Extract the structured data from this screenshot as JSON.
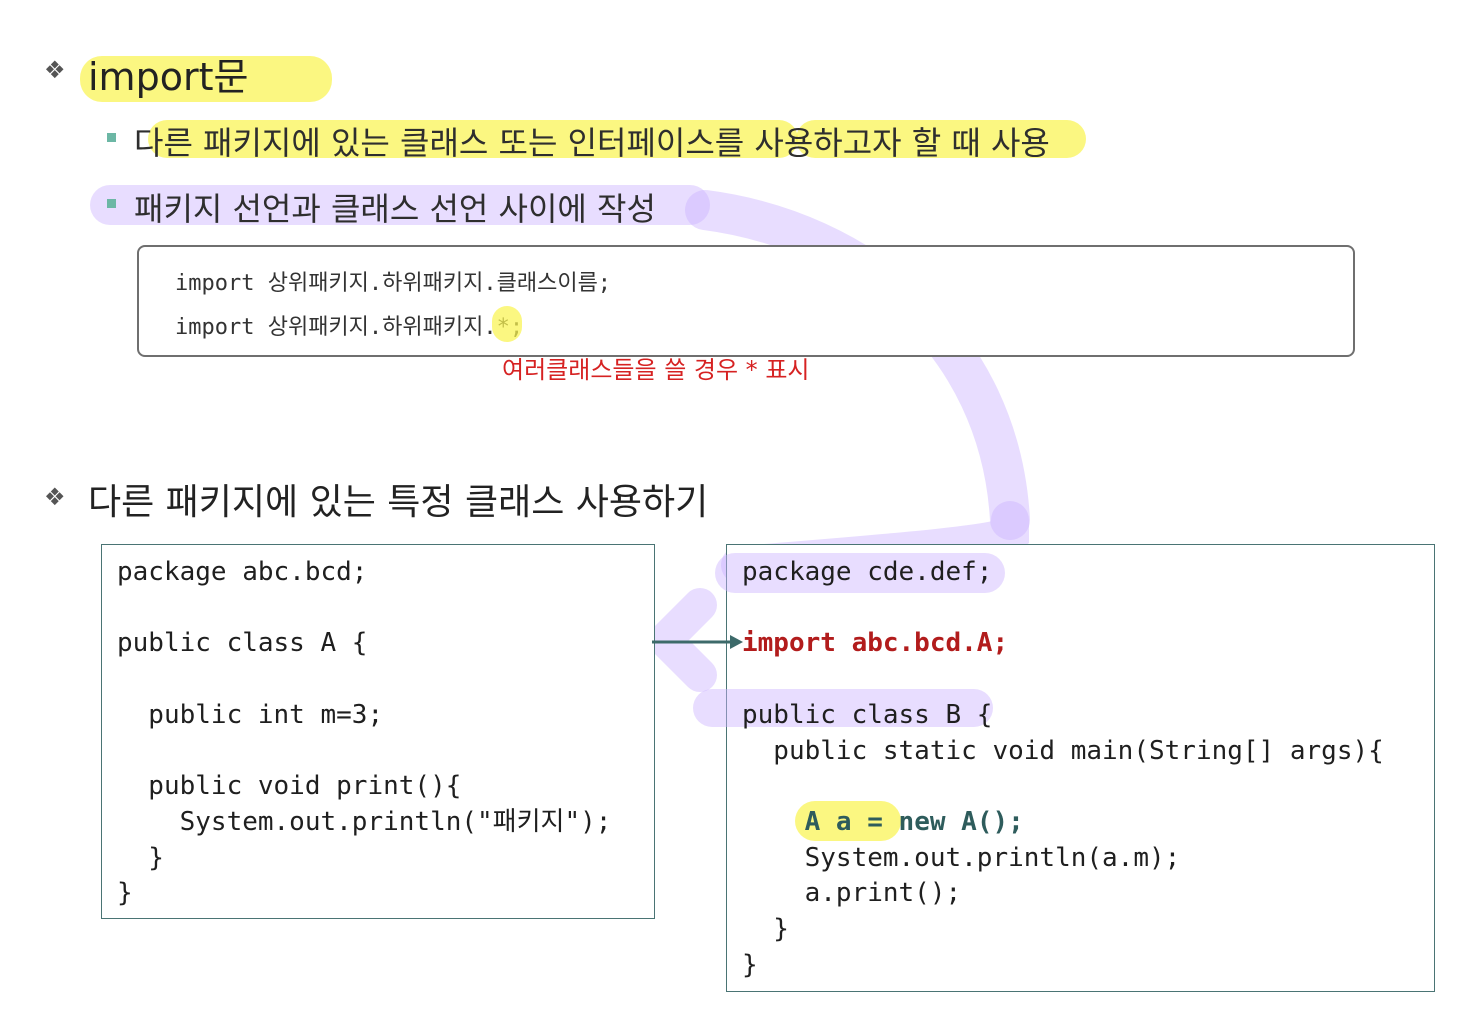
{
  "section1": {
    "title": "import문",
    "items": [
      "다른 패키지에 있는 클래스 또는 인터페이스를 사용하고자 할 때 사용",
      "패키지 선언과 클래스 선언 사이에 작성"
    ],
    "code_lines": [
      "import 상위패키지.하위패키지.클래스이름;",
      "import 상위패키지.하위패키지.*;"
    ],
    "note": "여러클래스들을 쓸 경우 * 표시"
  },
  "section2": {
    "title": "다른 패키지에 있는 특정 클래스 사용하기",
    "left_code": {
      "l1": "package abc.bcd;",
      "l2": "public class A {",
      "l3": "  public int m=3;",
      "l4": "  public void print(){",
      "l5": "    System.out.println(\"패키지\");",
      "l6": "  }",
      "l7": "}"
    },
    "right_code": {
      "l1": "package cde.def;",
      "import": "import abc.bcd.A;",
      "l2": "public class B {",
      "l3": "  public static void main(String[] args){",
      "l4a": "    A a = ",
      "l4b": "new A();",
      "l5": "    System.out.println(a.m);",
      "l6": "    a.print();",
      "l7": "  }",
      "l8": "}"
    }
  },
  "colors": {
    "highlight_yellow": "#faf450",
    "highlight_purple": "#cdb4ff",
    "note_red": "#d62222",
    "import_red": "#b21c1c",
    "bullet_teal": "#6cb7a5",
    "box_border": "#4a7474"
  },
  "icons": [
    "diamond-bullet-icon",
    "square-bullet-icon",
    "arrow-right-icon"
  ]
}
